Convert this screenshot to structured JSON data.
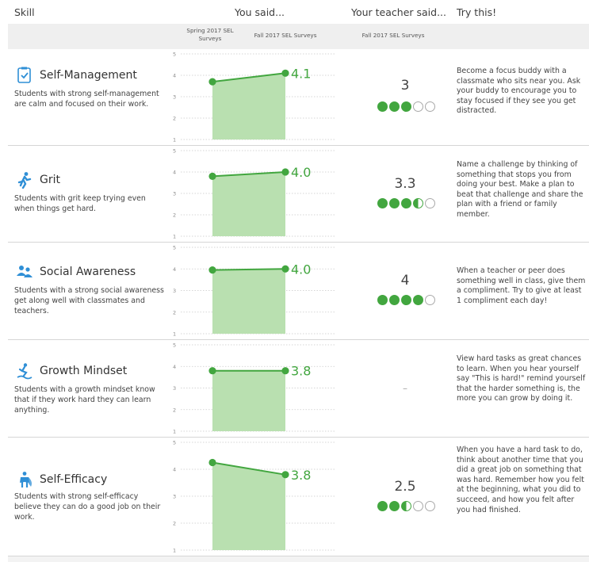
{
  "header": {
    "skill": "Skill",
    "you_said": "You said...",
    "teacher_said": "Your teacher said...",
    "try_this": "Try this!"
  },
  "subheader": {
    "spring": "Spring 2017 SEL Surveys",
    "fall": "Fall 2017 SEL Surveys",
    "teacher_fall": "Fall 2017 SEL Surveys"
  },
  "colors": {
    "accent": "#42a63f",
    "area_fill": "#b9e0b0",
    "icon_blue": "#2f8fd6"
  },
  "chart_data": [
    {
      "type": "area",
      "title": "Self-Management",
      "categories": [
        "Spring 2017 SEL Surveys",
        "Fall 2017 SEL Surveys"
      ],
      "values": [
        3.7,
        4.1
      ],
      "ylim": [
        1,
        5
      ],
      "y_ticks": [
        "1",
        "2",
        "3",
        "4",
        "5"
      ],
      "end_label": "4.1",
      "grid": true
    },
    {
      "type": "area",
      "title": "Grit",
      "categories": [
        "Spring 2017 SEL Surveys",
        "Fall 2017 SEL Surveys"
      ],
      "values": [
        3.8,
        4.0
      ],
      "ylim": [
        1,
        5
      ],
      "y_ticks": [
        "1",
        "2",
        "3",
        "4",
        "5"
      ],
      "end_label": "4.0",
      "grid": true
    },
    {
      "type": "area",
      "title": "Social Awareness",
      "categories": [
        "Spring 2017 SEL Surveys",
        "Fall 2017 SEL Surveys"
      ],
      "values": [
        3.95,
        4.0
      ],
      "ylim": [
        1,
        5
      ],
      "y_ticks": [
        "1",
        "2",
        "3",
        "4",
        "5"
      ],
      "end_label": "4.0",
      "grid": true
    },
    {
      "type": "area",
      "title": "Growth Mindset",
      "categories": [
        "Spring 2017 SEL Surveys",
        "Fall 2017 SEL Surveys"
      ],
      "values": [
        3.8,
        3.8
      ],
      "ylim": [
        1,
        5
      ],
      "y_ticks": [
        "1",
        "2",
        "3",
        "4",
        "5"
      ],
      "end_label": "3.8",
      "grid": true
    },
    {
      "type": "area",
      "title": "Self-Efficacy",
      "categories": [
        "Spring 2017 SEL Surveys",
        "Fall 2017 SEL Surveys"
      ],
      "values": [
        4.25,
        3.8
      ],
      "ylim": [
        1,
        5
      ],
      "y_ticks": [
        "1",
        "2",
        "3",
        "4",
        "5"
      ],
      "end_label": "3.8",
      "grid": true
    }
  ],
  "skills": [
    {
      "name": "Self-Management",
      "icon": "clipboard-check-icon",
      "desc": "Students with strong self-management are calm and focused on their work.",
      "teacher_score": "3",
      "dots": [
        "full",
        "full",
        "full",
        "empty",
        "empty"
      ],
      "tip": "Become a focus buddy with a classmate who sits near you. Ask your buddy to encourage you to stay focused if they see you get distracted."
    },
    {
      "name": "Grit",
      "icon": "runner-icon",
      "desc": "Students with grit keep trying even when things get hard.",
      "teacher_score": "3.3",
      "dots": [
        "full",
        "full",
        "full",
        "half",
        "empty"
      ],
      "tip": "Name a challenge by thinking of something that stops you from doing your best. Make a plan to beat that challenge and share the plan with a friend or family member."
    },
    {
      "name": "Social Awareness",
      "icon": "people-icon",
      "desc": "Students with a strong social awareness get along well with classmates and teachers.",
      "teacher_score": "4",
      "dots": [
        "full",
        "full",
        "full",
        "full",
        "empty"
      ],
      "tip": "When a teacher or peer does something well in class, give them a compliment. Try to give at least 1 compliment each day!"
    },
    {
      "name": "Growth Mindset",
      "icon": "climber-icon",
      "desc": "Students with a growth mindset know that if they work hard they can learn anything.",
      "teacher_score": "–",
      "dots": [],
      "tip": "View hard tasks as great chances to learn. When you hear yourself say \"This is hard!\" remind yourself that the harder something is, the more you can grow by doing it."
    },
    {
      "name": "Self-Efficacy",
      "icon": "superhero-icon",
      "desc": "Students with strong self-efficacy believe they can do a good job on their work.",
      "teacher_score": "2.5",
      "dots": [
        "full",
        "full",
        "half",
        "empty",
        "empty"
      ],
      "tip": "When you have a hard task to do, think about another time that you did a great job on something that was hard. Remember how you felt at the beginning, what you did to succeed, and how you felt after you had finished."
    }
  ]
}
